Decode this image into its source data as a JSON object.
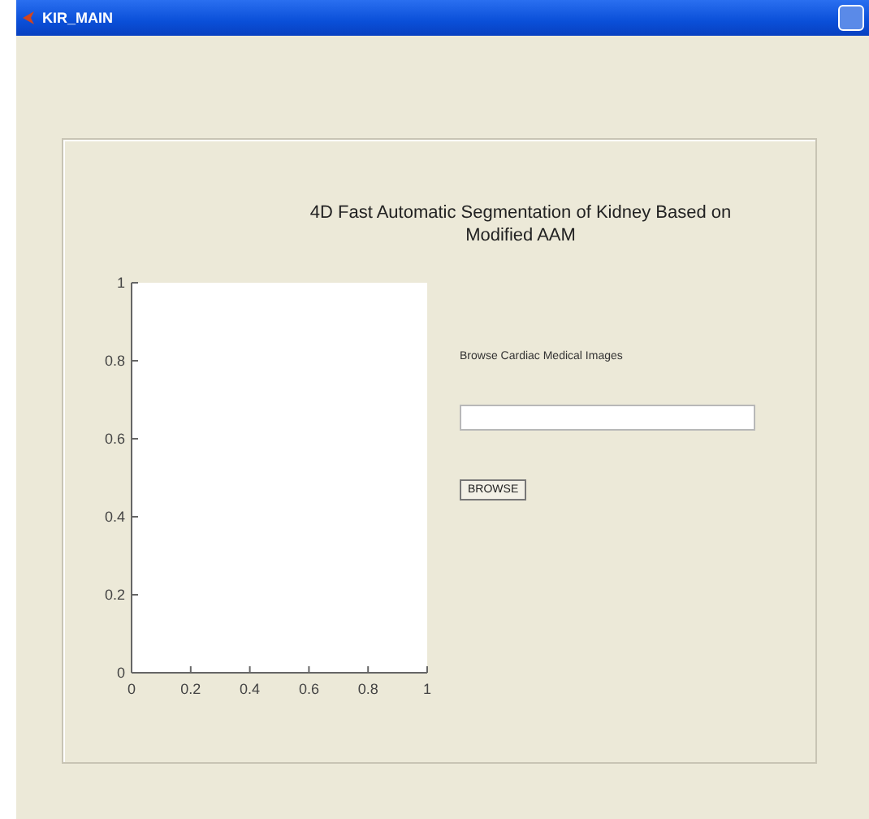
{
  "window": {
    "title": "KIR_MAIN"
  },
  "panel": {
    "heading": "4D Fast Automatic Segmentation of Kidney Based on\nModified AAM",
    "axes": {
      "chart_data": {
        "type": "line",
        "xlim": [
          0,
          1
        ],
        "ylim": [
          0,
          1
        ],
        "xticks": [
          {
            "value": 0,
            "label": "0"
          },
          {
            "value": 0.2,
            "label": "0.2"
          },
          {
            "value": 0.4,
            "label": "0.4"
          },
          {
            "value": 0.6,
            "label": "0.6"
          },
          {
            "value": 0.8,
            "label": "0.8"
          },
          {
            "value": 1,
            "label": "1"
          }
        ],
        "yticks": [
          {
            "value": 0,
            "label": "0"
          },
          {
            "value": 0.2,
            "label": "0.2"
          },
          {
            "value": 0.4,
            "label": "0.4"
          },
          {
            "value": 0.6,
            "label": "0.6"
          },
          {
            "value": 0.8,
            "label": "0.8"
          },
          {
            "value": 1,
            "label": "1"
          }
        ]
      }
    },
    "browse_label": "Browse Cardiac Medical Images",
    "browse_button": "BROWSE"
  }
}
